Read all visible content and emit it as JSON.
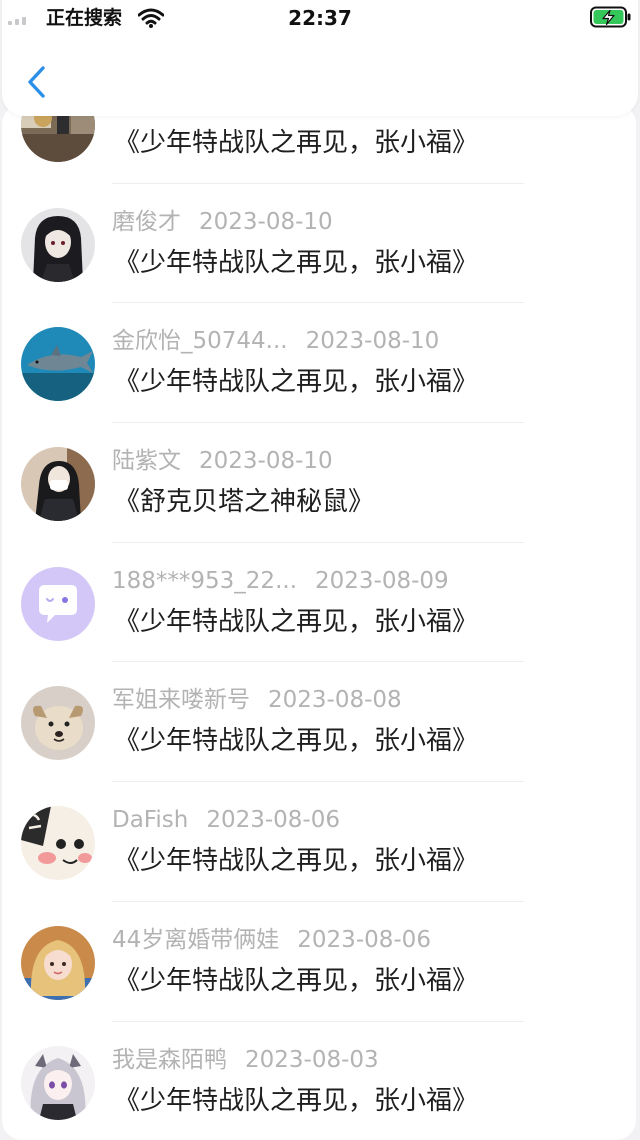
{
  "status_bar": {
    "carrier": "正在搜索",
    "time": "22:37"
  },
  "nav": {
    "back_icon": "chevron-left-icon",
    "accent_color": "#2b8fe8"
  },
  "comments": [
    {
      "username": "",
      "date": "",
      "title": "《少年特战队之再见，张小福》",
      "avatar": "partial-photo-avatar"
    },
    {
      "username": "磨俊才",
      "date": "2023-08-10",
      "title": "《少年特战队之再见，张小福》",
      "avatar": "anime-girl-dark-hair-avatar"
    },
    {
      "username": "金欣怡_50744...",
      "date": "2023-08-10",
      "title": "《少年特战队之再见，张小福》",
      "avatar": "shark-underwater-avatar"
    },
    {
      "username": "陆紫文",
      "date": "2023-08-10",
      "title": "《舒克贝塔之神秘鼠》",
      "avatar": "masked-person-avatar"
    },
    {
      "username": "188***953_22...",
      "date": "2023-08-09",
      "title": "《少年特战队之再见，张小福》",
      "avatar": "default-chat-bubble-avatar"
    },
    {
      "username": "军姐来喽新号",
      "date": "2023-08-08",
      "title": "《少年特战队之再见，张小福》",
      "avatar": "dog-avatar"
    },
    {
      "username": "DaFish",
      "date": "2023-08-06",
      "title": "《少年特战队之再见，张小福》",
      "avatar": "cartoon-face-avatar"
    },
    {
      "username": "44岁离婚带俩娃",
      "date": "2023-08-06",
      "title": "《少年特战队之再见，张小福》",
      "avatar": "blonde-girl-avatar"
    },
    {
      "username": "我是森陌鸭",
      "date": "2023-08-03",
      "title": "《少年特战队之再见，张小福》",
      "avatar": "anime-silver-hair-avatar"
    }
  ]
}
